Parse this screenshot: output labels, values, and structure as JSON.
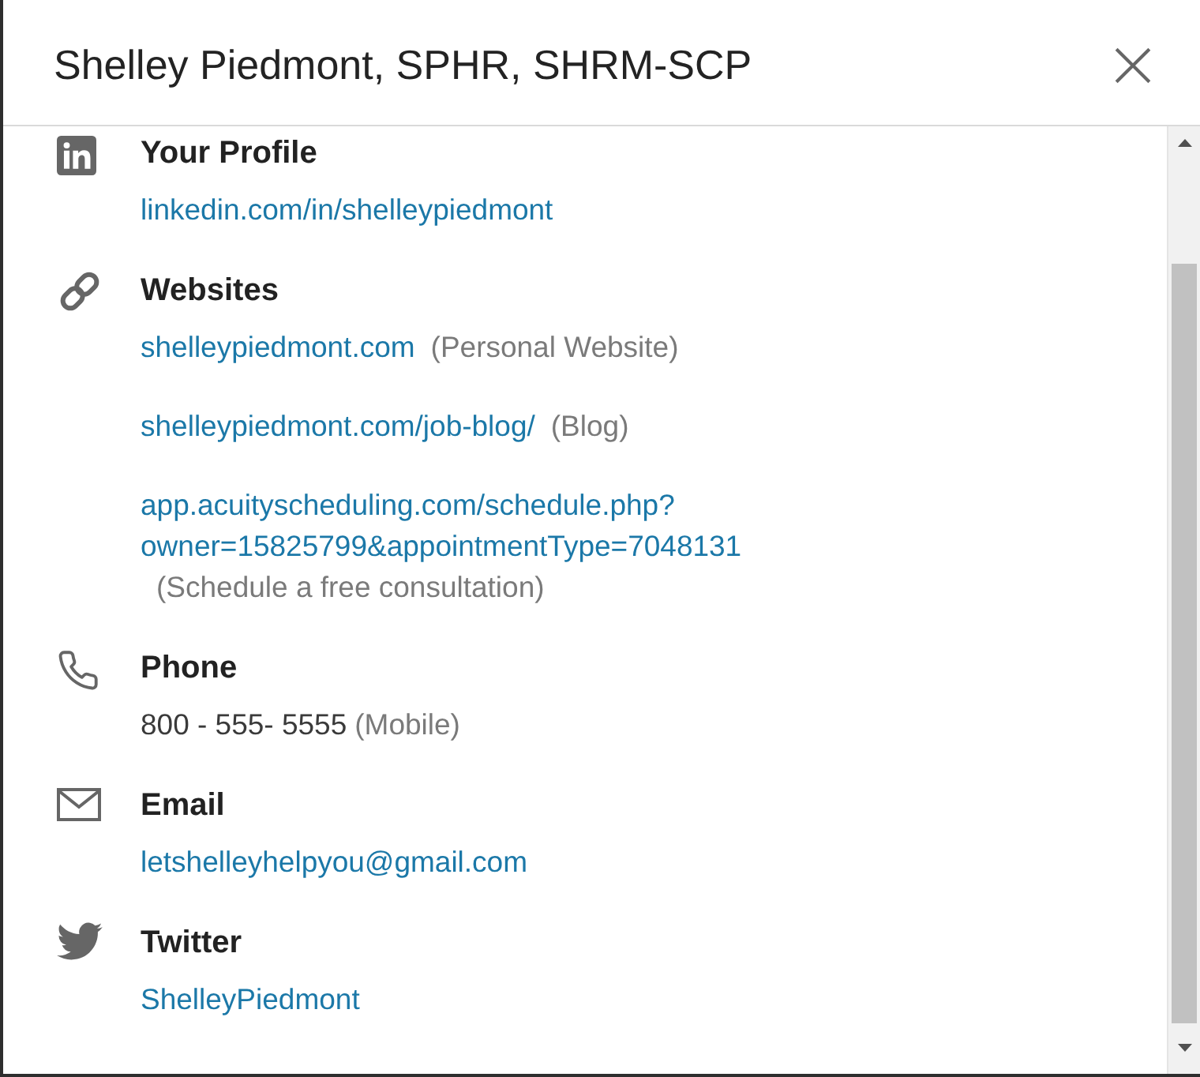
{
  "dialog": {
    "title": "Shelley Piedmont, SPHR, SHRM-SCP"
  },
  "sections": [
    {
      "kind": "profile",
      "heading": "Your Profile",
      "entries": [
        {
          "kind": "link",
          "value": "linkedin.com/in/shelleypiedmont"
        }
      ]
    },
    {
      "kind": "websites",
      "heading": "Websites",
      "entries": [
        {
          "kind": "link",
          "value": "shelleypiedmont.com",
          "note": "(Personal Website)"
        },
        {
          "kind": "link",
          "value": "shelleypiedmont.com/job-blog/",
          "note": "(Blog)"
        },
        {
          "kind": "link",
          "value": "app.acuityscheduling.com/schedule.php?owner=15825799&appointmentType=7048131",
          "note": "(Schedule a free consultation)"
        }
      ]
    },
    {
      "kind": "phone",
      "heading": "Phone",
      "entries": [
        {
          "kind": "text",
          "value": "800 - 555- 5555",
          "note": "(Mobile)"
        }
      ]
    },
    {
      "kind": "email",
      "heading": "Email",
      "entries": [
        {
          "kind": "link",
          "value": "letshelleyhelpyou@gmail.com"
        }
      ]
    },
    {
      "kind": "twitter",
      "heading": "Twitter",
      "entries": [
        {
          "kind": "link",
          "value": "ShelleyPiedmont"
        }
      ]
    }
  ]
}
